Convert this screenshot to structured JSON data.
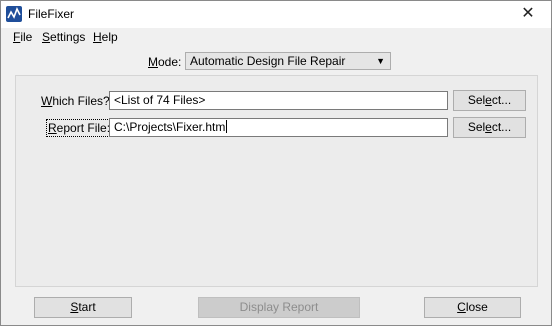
{
  "window": {
    "title": "FileFixer",
    "close_glyph": "✕",
    "app_icon": "app-logo-icon"
  },
  "menu": {
    "items": [
      {
        "label": "File",
        "key": "F",
        "rest": "ile"
      },
      {
        "label": "Settings",
        "key": "S",
        "rest": "ettings"
      },
      {
        "label": "Help",
        "key": "H",
        "rest": "elp"
      }
    ]
  },
  "mode": {
    "label_key": "M",
    "label_rest": "ode:",
    "value": "Automatic Design File Repair",
    "arrow": "▼"
  },
  "which_files": {
    "label_key": "W",
    "label_rest": "hich Files?",
    "value": "<List of 74 Files>",
    "button_pre": "Sel",
    "button_key": "e",
    "button_post": "ct..."
  },
  "report_file": {
    "label_key": "R",
    "label_rest": "eport File:",
    "value": "C:\\Projects\\Fixer.htm",
    "button_pre": "Sel",
    "button_key": "e",
    "button_post": "ct..."
  },
  "buttons": {
    "start_key": "S",
    "start_rest": "tart",
    "display_report": "Display Report",
    "close_key": "C",
    "close_rest": "lose"
  }
}
